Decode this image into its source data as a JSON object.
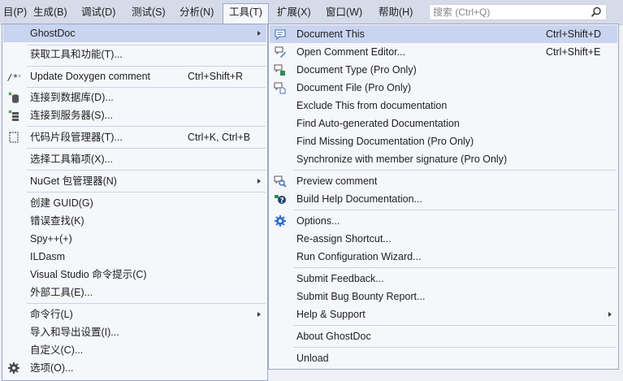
{
  "menubar": {
    "items": [
      "目(P)",
      "生成(B)",
      "调试(D)",
      "测试(S)",
      "分析(N)",
      "工具(T)",
      "扩展(X)",
      "窗口(W)",
      "帮助(H)"
    ],
    "search_placeholder": "搜索 (Ctrl+Q)"
  },
  "tools_menu": {
    "ghostdoc": "GhostDoc",
    "get_tools": "获取工具和功能(T)...",
    "doxygen": "Update Doxygen comment",
    "doxygen_shortcut": "Ctrl+Shift+R",
    "connect_db": "连接到数据库(D)...",
    "connect_server": "连接到服务器(S)...",
    "snippets": "代码片段管理器(T)...",
    "snippets_shortcut": "Ctrl+K, Ctrl+B",
    "choose_toolbox": "选择工具箱项(X)...",
    "nuget": "NuGet 包管理器(N)",
    "create_guid": "创建 GUID(G)",
    "error_lookup": "错误查找(K)",
    "spy": "Spy++(+)",
    "ildasm": "ILDasm",
    "vs_cmd": "Visual Studio 命令提示(C)",
    "external_tools": "外部工具(E)...",
    "command_line": "命令行(L)",
    "import_export": "导入和导出设置(I)...",
    "customize": "自定义(C)...",
    "options": "选项(O)..."
  },
  "ghostdoc_menu": {
    "document_this": "Document This",
    "document_this_shortcut": "Ctrl+Shift+D",
    "open_editor": "Open Comment Editor...",
    "open_editor_shortcut": "Ctrl+Shift+E",
    "document_type": "Document Type (Pro Only)",
    "document_file": "Document File (Pro Only)",
    "exclude": "Exclude This from documentation",
    "find_auto": "Find Auto-generated Documentation",
    "find_missing": "Find Missing Documentation (Pro Only)",
    "synchronize": "Synchronize with member signature (Pro Only)",
    "preview": "Preview comment",
    "build_help": "Build Help Documentation...",
    "options": "Options...",
    "reassign": "Re-assign Shortcut...",
    "wizard": "Run Configuration Wizard...",
    "feedback": "Submit Feedback...",
    "bug_bounty": "Submit Bug Bounty Report...",
    "help_support": "Help & Support",
    "about": "About GhostDoc",
    "unload": "Unload"
  },
  "colors": {
    "highlight": "#c9d4f0",
    "menu_bg": "#f5f7fb",
    "menubar_bg": "#d6dbe9",
    "border": "#9ea8c4"
  }
}
